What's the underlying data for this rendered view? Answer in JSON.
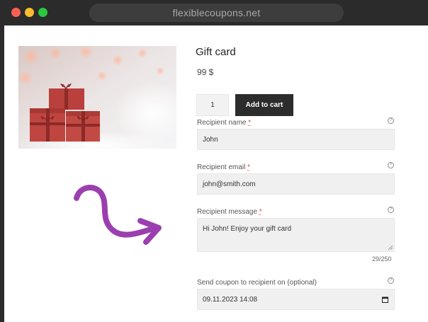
{
  "browser": {
    "url": "flexiblecoupons.net"
  },
  "product": {
    "image_alt": "Gift boxes with bows",
    "title": "Gift card",
    "price": "99 $",
    "quantity": "1",
    "add_to_cart_label": "Add to cart"
  },
  "form": {
    "recipient_name": {
      "label": "Recipient name",
      "required_mark": "*",
      "value": "John",
      "help_icon": "question-circle"
    },
    "recipient_email": {
      "label": "Recipient email",
      "required_mark": "*",
      "value": "john@smith.com",
      "help_icon": "question-circle"
    },
    "recipient_message": {
      "label": "Recipient message",
      "required_mark": "*",
      "value": "Hi John! Enjoy your gift card",
      "counter": "29/250",
      "help_icon": "question-circle"
    },
    "send_date": {
      "label": "Send coupon to recipient on (optional)",
      "value": "09.11.2023 14:08",
      "help_icon": "question-circle"
    }
  },
  "colors": {
    "accent_arrow": "#9b3fb0",
    "button_bg": "#2c2c2c",
    "field_bg": "#f0f0f0",
    "required": "#d04a4a"
  }
}
